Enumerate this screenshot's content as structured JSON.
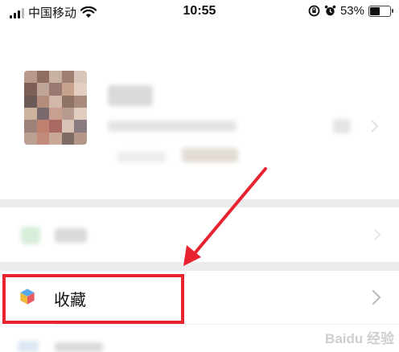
{
  "status_bar": {
    "carrier": "中国移动",
    "time": "10:55",
    "battery_percent": "53%",
    "battery_level": 0.53
  },
  "profile": {
    "note": ""
  },
  "menu": {
    "favorites_label": "收藏"
  },
  "colors": {
    "highlight": "#e8232f",
    "divider": "#ececec"
  },
  "watermark": {
    "text": "Baidu 经验"
  },
  "icons": [
    "signal-icon",
    "wifi-icon",
    "rotation-lock-icon",
    "alarm-icon",
    "battery-icon",
    "favorites-cube-icon",
    "chevron-right-icon"
  ]
}
